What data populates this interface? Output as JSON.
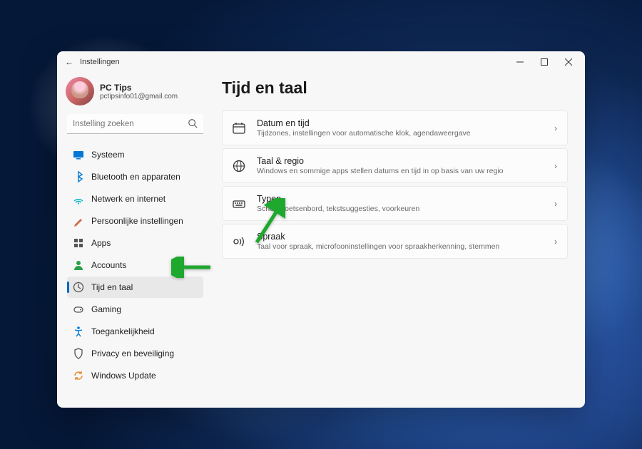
{
  "window": {
    "title": "Instellingen"
  },
  "profile": {
    "name": "PC Tips",
    "email": "pctipsinfo01@gmail.com"
  },
  "search": {
    "placeholder": "Instelling zoeken"
  },
  "sidebar": {
    "items": [
      {
        "label": "Systeem",
        "name": "system",
        "icon_color": "#0078d4"
      },
      {
        "label": "Bluetooth en apparaten",
        "name": "bluetooth",
        "icon_color": "#0078d4"
      },
      {
        "label": "Netwerk en internet",
        "name": "network",
        "icon_color": "#00b7c3"
      },
      {
        "label": "Persoonlijke instellingen",
        "name": "personalization",
        "icon_color": "#d06c4a"
      },
      {
        "label": "Apps",
        "name": "apps",
        "icon_color": "#555"
      },
      {
        "label": "Accounts",
        "name": "accounts",
        "icon_color": "#2aa148"
      },
      {
        "label": "Tijd en taal",
        "name": "time-language",
        "icon_color": "#555",
        "active": true
      },
      {
        "label": "Gaming",
        "name": "gaming",
        "icon_color": "#555"
      },
      {
        "label": "Toegankelijkheid",
        "name": "accessibility",
        "icon_color": "#0078d4"
      },
      {
        "label": "Privacy en beveiliging",
        "name": "privacy",
        "icon_color": "#555"
      },
      {
        "label": "Windows Update",
        "name": "update",
        "icon_color": "#e88b2e"
      }
    ]
  },
  "main": {
    "heading": "Tijd en taal",
    "cards": [
      {
        "name": "date-time",
        "title": "Datum en tijd",
        "sub": "Tijdzones, instellingen voor automatische klok, agendaweergave"
      },
      {
        "name": "language-region",
        "title": "Taal & regio",
        "sub": "Windows en sommige apps stellen datums en tijd in op basis van uw regio"
      },
      {
        "name": "typing",
        "title": "Typen",
        "sub": "Schermtoetsenbord, tekstsuggesties, voorkeuren"
      },
      {
        "name": "speech",
        "title": "Spraak",
        "sub": "Taal voor spraak, microfooninstellingen voor spraakherkenning, stemmen"
      }
    ]
  },
  "annotation": {
    "color": "#1fa82e"
  }
}
